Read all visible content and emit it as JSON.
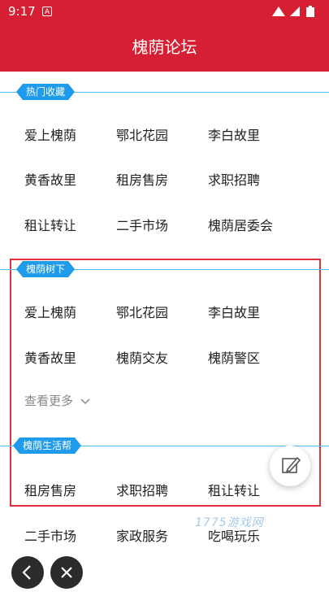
{
  "status_bar": {
    "time": "9:17",
    "badge": "A"
  },
  "header": {
    "title": "槐荫论坛"
  },
  "sections": {
    "hot": {
      "tag": "热门收藏",
      "items": [
        "爱上槐荫",
        "鄂北花园",
        "李白故里",
        "黄香故里",
        "租房售房",
        "求职招聘",
        "租让转让",
        "二手市场",
        "槐荫居委会"
      ]
    },
    "tree": {
      "tag": "槐荫树下",
      "items": [
        "爱上槐荫",
        "鄂北花园",
        "李白故里",
        "黄香故里",
        "槐荫交友",
        "槐荫警区"
      ],
      "more": "查看更多"
    },
    "life": {
      "tag": "槐荫生活帮",
      "items": [
        "租房售房",
        "求职招聘",
        "租让转让",
        "二手市场",
        "家政服务",
        "吃喝玩乐"
      ]
    }
  },
  "watermark": "1775游戏网",
  "colors": {
    "brand_red": "#d61f33",
    "tag_blue": "#1e9bea",
    "line_blue": "#4fc3f7",
    "highlight": "#e0323c"
  },
  "icons": [
    "signal-icon",
    "wifi-icon",
    "battery-icon",
    "edit-icon",
    "back-icon",
    "close-icon",
    "chevron-down-icon"
  ]
}
